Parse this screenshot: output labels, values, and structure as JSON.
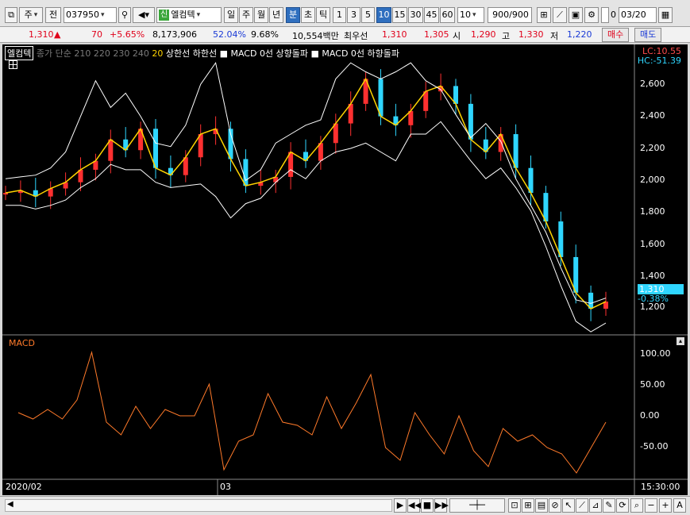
{
  "toolbar": {
    "market_type": "주",
    "whole_label": "전",
    "stock_code": "037950",
    "name_badge": "신",
    "stock_name": "엘컴텍",
    "periods": [
      "일",
      "주",
      "월",
      "년",
      "분",
      "초",
      "틱"
    ],
    "active_period": "분",
    "intervals": [
      "1",
      "3",
      "5",
      "10",
      "15",
      "30",
      "45",
      "60"
    ],
    "active_interval": "10",
    "interval_select": "10",
    "count": "900/900",
    "date": "03/20",
    "checkbox_label": "0"
  },
  "quote": {
    "price": "1,310",
    "change_arrow": "▲",
    "change": "70",
    "change_pct": "+5.65%",
    "volume": "8,173,906",
    "ratio1": "52.04%",
    "ratio2": "9.68%",
    "amount": "10,554백만",
    "priority_label": "최우선",
    "ask": "1,310",
    "bid": "1,305",
    "open_label": "시",
    "open": "1,290",
    "high_label": "고",
    "high": "1,330",
    "low_label": "저",
    "low": "1,220",
    "buy_label": "매수",
    "sell_label": "매도"
  },
  "legend": {
    "name": "엘컴텍",
    "ma_text": "종가 단순 210 220 230 240",
    "twenty": "20",
    "upper": "상한선",
    "lower": "하한선",
    "macd_up": "■ MACD 0선 상향돌파",
    "macd_down": "■ MACD 0선 하향돌파"
  },
  "indicators": {
    "lc": "LC:10.55",
    "hc": "HC:-51.39",
    "current_price": "1,310",
    "current_change": "-0.38%",
    "macd_title": "MACD"
  },
  "axes": {
    "price_ticks": [
      "2,600",
      "2,400",
      "2,200",
      "2,000",
      "1,800",
      "1,600",
      "1,400",
      "1,200"
    ],
    "macd_ticks": [
      "100.00",
      "50.00",
      "0.00",
      "-50.00"
    ],
    "date_labels": [
      "2020/02",
      "03"
    ],
    "time_label": "15:30:00"
  },
  "colors": {
    "up_candle": "#ff3030",
    "down_candle": "#2fd6ff",
    "ma_line": "#ffd400",
    "band": "#ffffff",
    "macd_line": "#ff7a2a"
  },
  "chart_data": [
    {
      "type": "line",
      "title": "",
      "ylim": [
        1150,
        2700
      ],
      "series": [
        {
          "name": "20",
          "values": [
            1920,
            1935,
            1900,
            1945,
            1980,
            2050,
            2100,
            2220,
            2160,
            2280,
            2060,
            2020,
            2120,
            2250,
            2280,
            2110,
            1960,
            1980,
            2010,
            2150,
            2100,
            2200,
            2310,
            2420,
            2560,
            2350,
            2300,
            2380,
            2490,
            2520,
            2420,
            2220,
            2150,
            2250,
            2060,
            1920,
            1760,
            1560,
            1360,
            1270,
            1310
          ]
        },
        {
          "name": "상한선",
          "values": [
            2000,
            2010,
            2020,
            2060,
            2150,
            2350,
            2550,
            2400,
            2480,
            2350,
            2200,
            2180,
            2300,
            2530,
            2650,
            2250,
            1990,
            2050,
            2200,
            2250,
            2300,
            2330,
            2560,
            2650,
            2600,
            2560,
            2600,
            2650,
            2550,
            2500,
            2360,
            2230,
            2310,
            2210,
            2000,
            1850,
            1700,
            1500,
            1320,
            1300,
            1330
          ]
        },
        {
          "name": "하한선",
          "values": [
            1850,
            1850,
            1830,
            1850,
            1880,
            1950,
            2000,
            2080,
            2050,
            2050,
            1980,
            1950,
            1960,
            1970,
            1900,
            1780,
            1860,
            1890,
            1980,
            2050,
            2000,
            2100,
            2150,
            2170,
            2200,
            2150,
            2100,
            2250,
            2250,
            2320,
            2210,
            2100,
            2000,
            2060,
            1950,
            1820,
            1620,
            1400,
            1200,
            1140,
            1190
          ]
        }
      ]
    },
    {
      "type": "line",
      "title": "MACD",
      "ylim": [
        -80,
        120
      ],
      "series": [
        {
          "name": "MACD",
          "values": [
            15,
            5,
            20,
            5,
            35,
            110,
            0,
            -20,
            25,
            -10,
            20,
            10,
            10,
            60,
            -75,
            -30,
            -20,
            45,
            0,
            -5,
            -20,
            40,
            -10,
            30,
            75,
            -40,
            -60,
            15,
            -20,
            -50,
            10,
            -45,
            -70,
            -10,
            -30,
            -20,
            -40,
            -50,
            -80,
            -40,
            0
          ]
        }
      ]
    }
  ]
}
